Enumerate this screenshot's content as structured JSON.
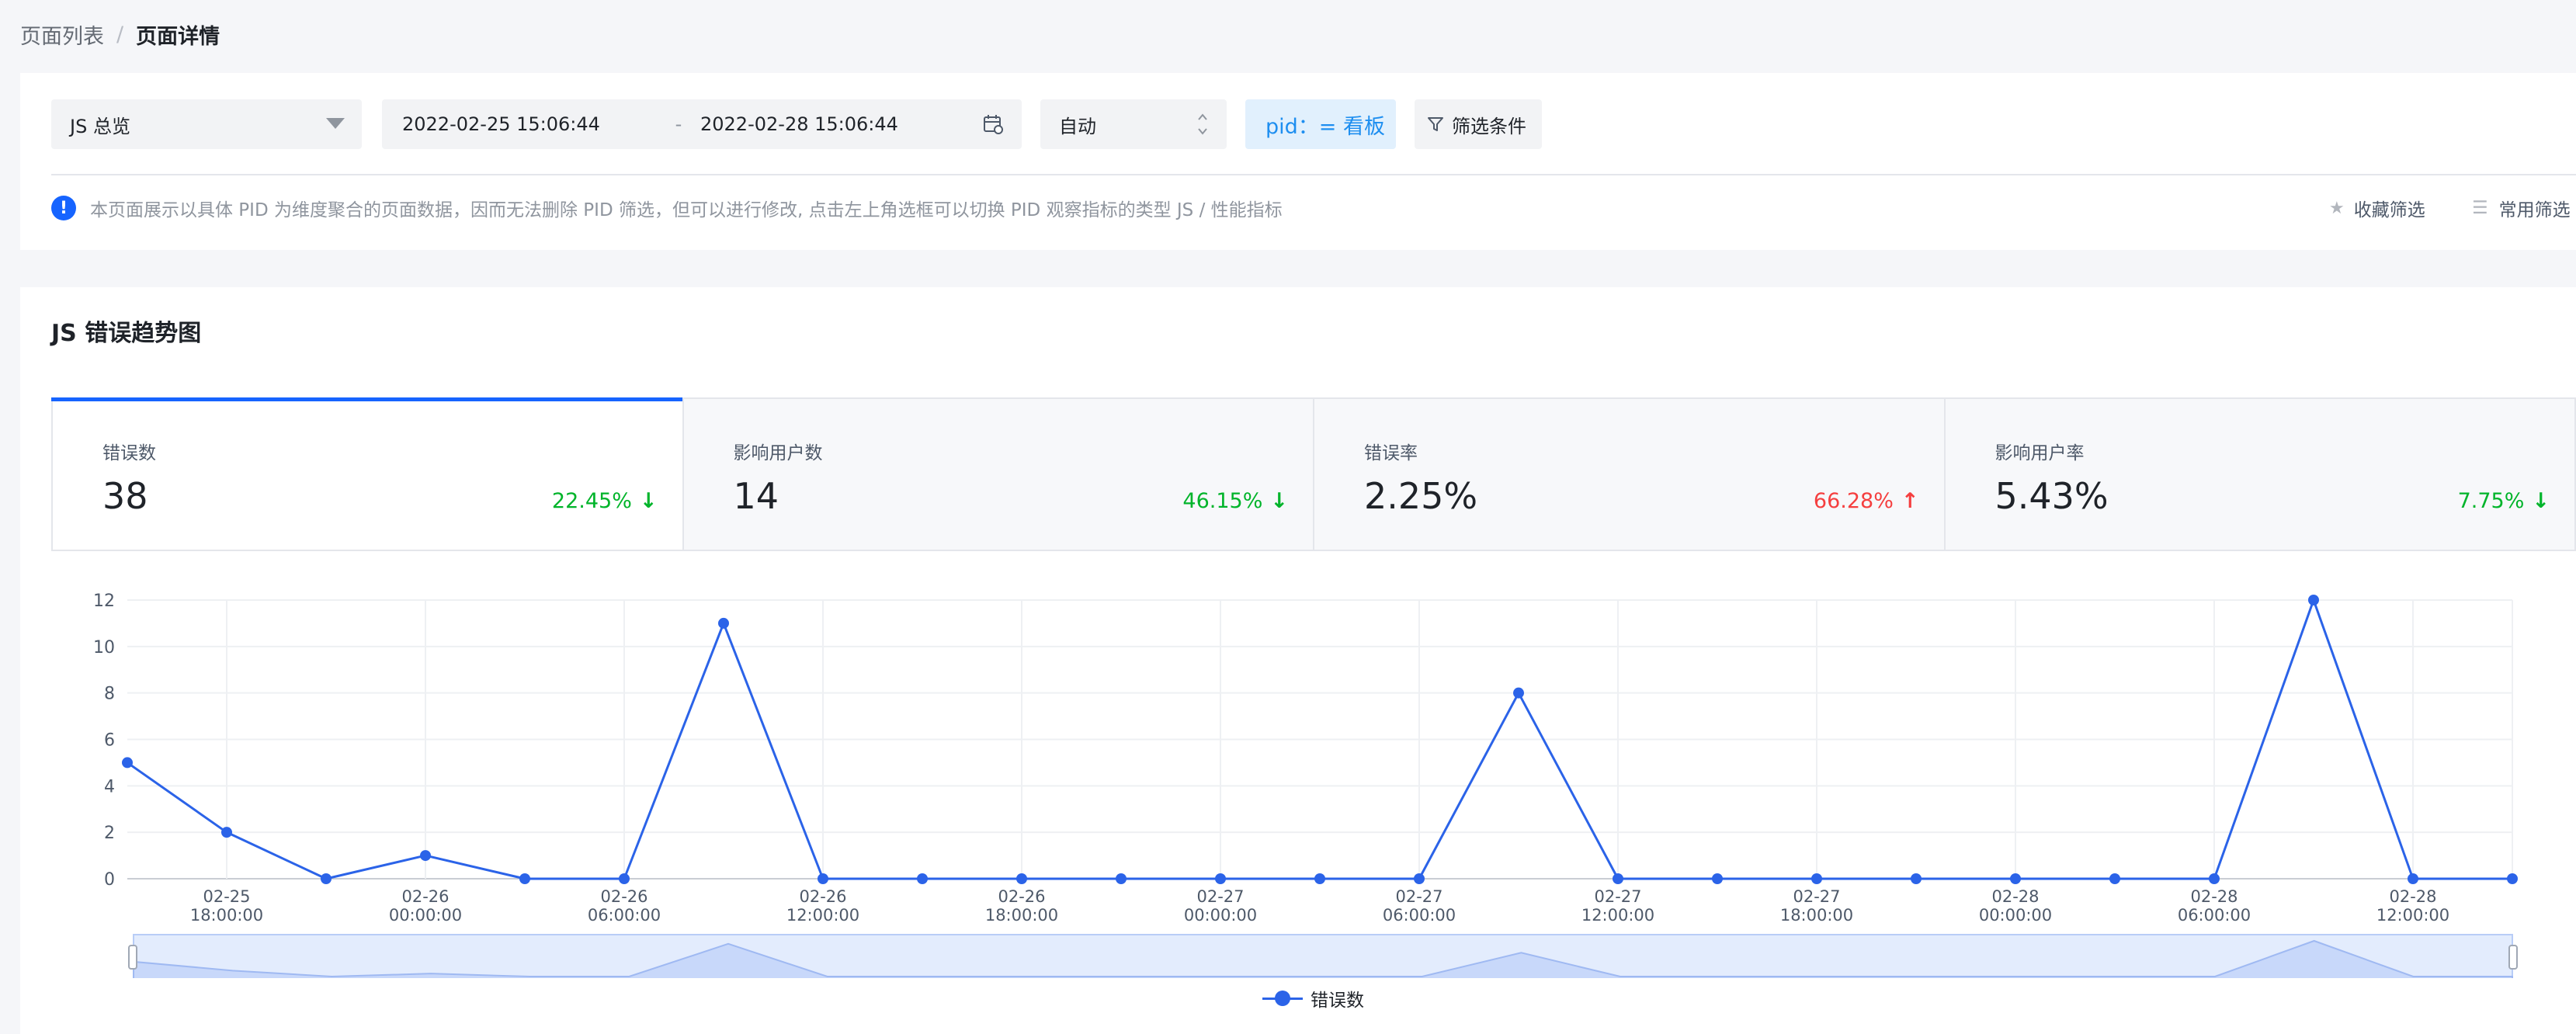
{
  "breadcrumb": {
    "list": "页面列表",
    "sep": "/",
    "current": "页面详情"
  },
  "filters": {
    "view_select": "JS 总览",
    "date_start": "2022-02-25 15:06:44",
    "date_sep": "-",
    "date_end": "2022-02-28 15:06:44",
    "granularity": "自动",
    "pid_tag": "pid：= 看板",
    "filter_button": "筛选条件",
    "notice": "本页面展示以具体 PID 为维度聚合的页面数据，因而无法删除 PID 筛选，但可以进行修改, 点击左上角选框可以切换 PID 观察指标的类型 JS / 性能指标",
    "favorite": "收藏筛选",
    "common": "常用筛选"
  },
  "section": {
    "title": "JS 错误趋势图"
  },
  "kpis": [
    {
      "label": "错误数",
      "value": "38",
      "change": "22.45%",
      "direction": "down"
    },
    {
      "label": "影响用户数",
      "value": "14",
      "change": "46.15%",
      "direction": "down"
    },
    {
      "label": "错误率",
      "value": "2.25%",
      "change": "66.28%",
      "direction": "up"
    },
    {
      "label": "影响用户率",
      "value": "5.43%",
      "change": "7.75%",
      "direction": "down"
    }
  ],
  "colors": {
    "accent": "#1664ff",
    "line": "#2b63e8",
    "down": "#00b42a",
    "up": "#f53f3f"
  },
  "chart_data": {
    "type": "line",
    "title": "",
    "xlabel": "",
    "ylabel": "",
    "ylim": [
      0,
      12
    ],
    "yticks": [
      "0",
      "2",
      "4",
      "6",
      "8",
      "10",
      "12"
    ],
    "x": [
      "02-25 15:00:00",
      "02-25 18:00:00",
      "02-25 21:00:00",
      "02-26 00:00:00",
      "02-26 03:00:00",
      "02-26 06:00:00",
      "02-26 09:00:00",
      "02-26 12:00:00",
      "02-26 15:00:00",
      "02-26 18:00:00",
      "02-26 21:00:00",
      "02-27 00:00:00",
      "02-27 03:00:00",
      "02-27 06:00:00",
      "02-27 09:00:00",
      "02-27 12:00:00",
      "02-27 15:00:00",
      "02-27 18:00:00",
      "02-27 21:00:00",
      "02-28 00:00:00",
      "02-28 03:00:00",
      "02-28 06:00:00",
      "02-28 09:00:00",
      "02-28 12:00:00",
      "02-28 15:00:00"
    ],
    "tick_labels": [
      {
        "date": "02-25",
        "time": "18:00:00"
      },
      {
        "date": "02-26",
        "time": "00:00:00"
      },
      {
        "date": "02-26",
        "time": "06:00:00"
      },
      {
        "date": "02-26",
        "time": "12:00:00"
      },
      {
        "date": "02-26",
        "time": "18:00:00"
      },
      {
        "date": "02-27",
        "time": "00:00:00"
      },
      {
        "date": "02-27",
        "time": "06:00:00"
      },
      {
        "date": "02-27",
        "time": "12:00:00"
      },
      {
        "date": "02-27",
        "time": "18:00:00"
      },
      {
        "date": "02-28",
        "time": "00:00:00"
      },
      {
        "date": "02-28",
        "time": "06:00:00"
      },
      {
        "date": "02-28",
        "time": "12:00:00"
      }
    ],
    "series": [
      {
        "name": "错误数",
        "values": [
          5,
          2,
          0,
          1,
          0,
          0,
          11,
          0,
          0,
          0,
          0,
          0,
          0,
          0,
          8,
          0,
          0,
          0,
          0,
          0,
          0,
          0,
          12,
          0,
          0
        ]
      }
    ],
    "grid": true,
    "legend": "bottom-center"
  }
}
